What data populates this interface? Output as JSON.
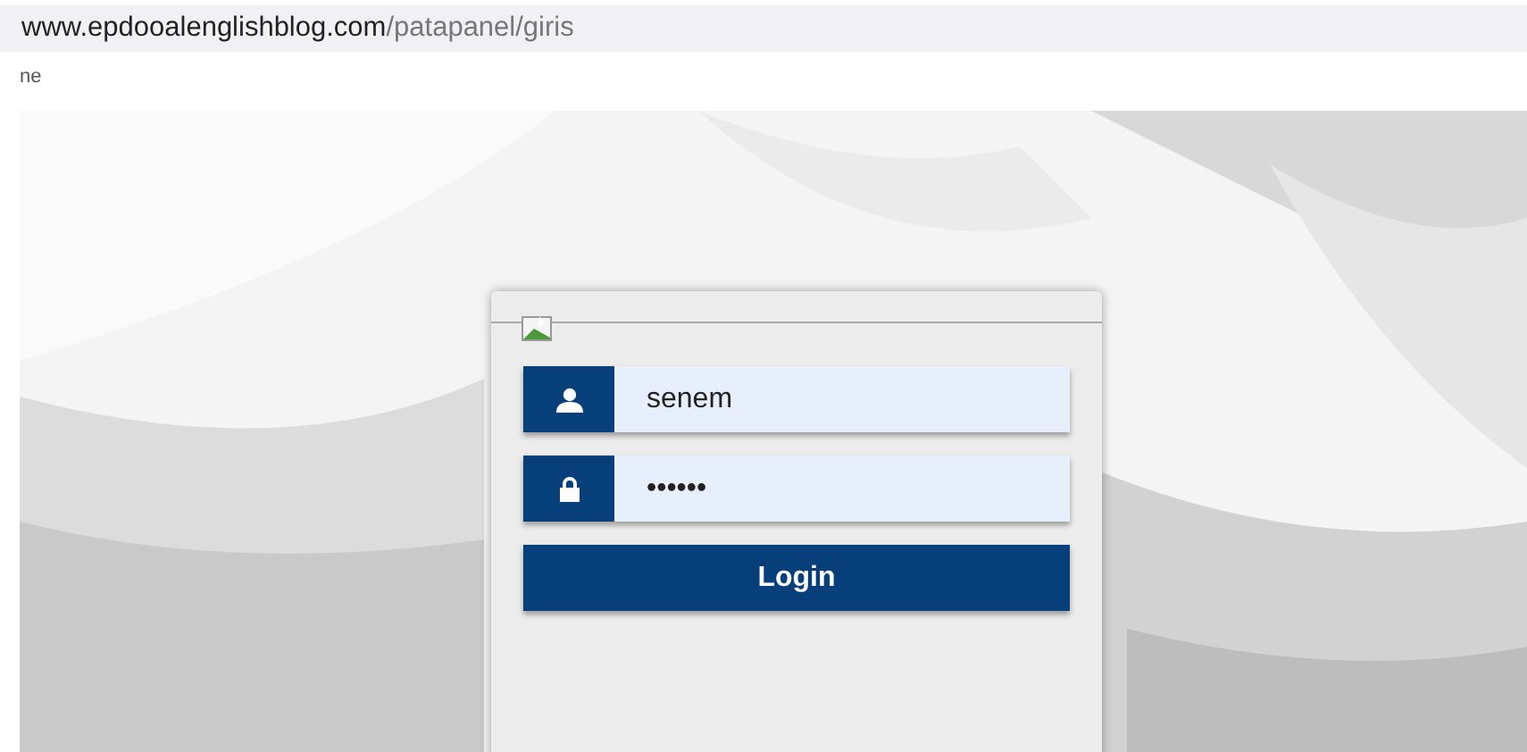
{
  "address_bar": {
    "domain": "www.epdooalenglishblog.com",
    "path": "/patapanel/giris"
  },
  "page_fragment": "ne",
  "login_form": {
    "logo": {
      "broken": true
    },
    "username": {
      "value": "senem"
    },
    "password": {
      "value": "••••••"
    },
    "submit": {
      "label": "Login"
    }
  }
}
